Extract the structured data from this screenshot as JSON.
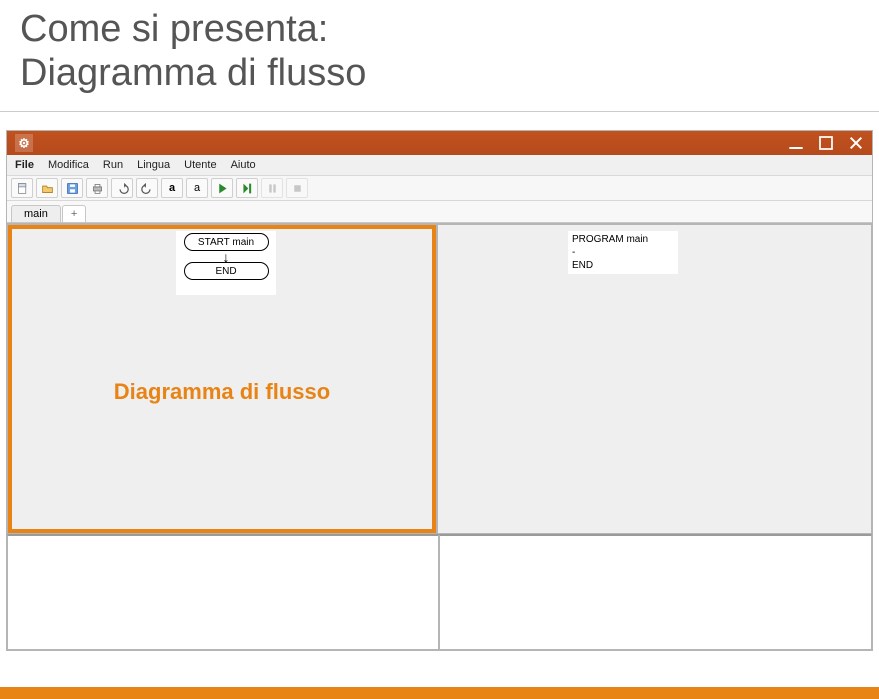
{
  "slide": {
    "title_line1": "Come si presenta:",
    "title_line2": "Diagramma di flusso"
  },
  "menubar": {
    "file": "File",
    "modifica": "Modifica",
    "run": "Run",
    "lingua": "Lingua",
    "utente": "Utente",
    "aiuto": "Aiuto"
  },
  "tabs": {
    "main": "main",
    "plus": "+"
  },
  "flowchart": {
    "start": "START main",
    "end": "END"
  },
  "pane_flow_label": "Diagramma di flusso",
  "code_panel": {
    "line1": "PROGRAM main",
    "line2": "-",
    "line3": "END"
  }
}
